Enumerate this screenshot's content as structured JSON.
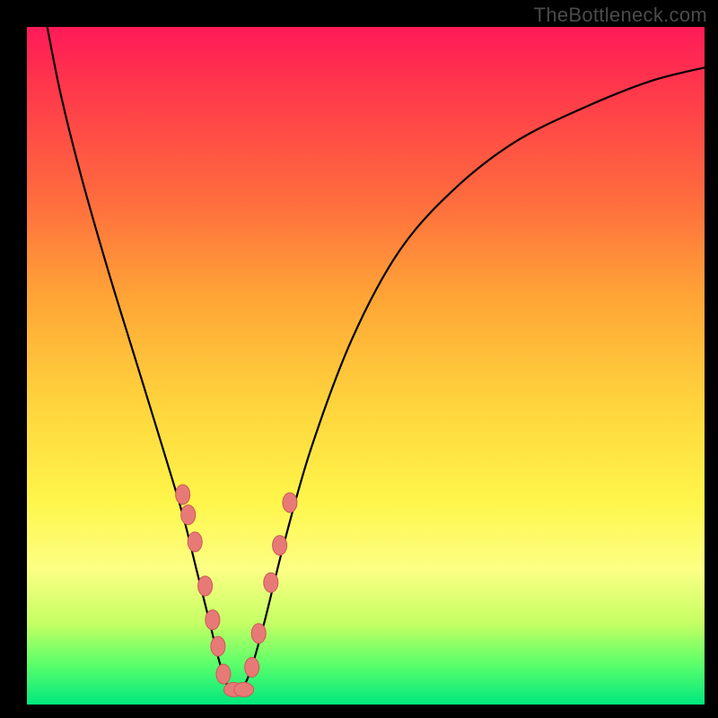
{
  "watermark": "TheBottleneck.com",
  "colors": {
    "page_bg": "#000000",
    "watermark": "#4b4b4b",
    "curve_stroke": "#000000",
    "marker_fill": "#e77a77",
    "marker_stroke": "#cc5a57"
  },
  "chart_data": {
    "type": "line",
    "title": "",
    "xlabel": "",
    "ylabel": "",
    "xlim": [
      0,
      100
    ],
    "ylim": [
      0,
      100
    ],
    "grid": false,
    "legend": false,
    "series": [
      {
        "name": "curve",
        "x": [
          3,
          5,
          8,
          12,
          16,
          20,
          23,
          25,
          27,
          28.5,
          30,
          31.5,
          33,
          35,
          38,
          42,
          48,
          55,
          63,
          72,
          82,
          92,
          100
        ],
        "y": [
          100,
          90,
          78,
          64,
          51,
          38,
          28,
          20,
          12,
          6,
          2,
          2,
          5,
          12,
          24,
          38,
          54,
          67,
          76,
          83,
          88,
          92,
          94
        ]
      }
    ],
    "highlighted_points": {
      "name": "markers",
      "x": [
        23,
        23.8,
        24.8,
        26.3,
        27.4,
        28.2,
        29,
        30.5,
        32,
        33.2,
        34.2,
        36,
        37.3,
        38.8
      ],
      "y": [
        31,
        28,
        24,
        17.5,
        12.5,
        8.6,
        4.5,
        2.2,
        2.2,
        5.5,
        10.5,
        18.0,
        23.5,
        29.8
      ]
    }
  }
}
